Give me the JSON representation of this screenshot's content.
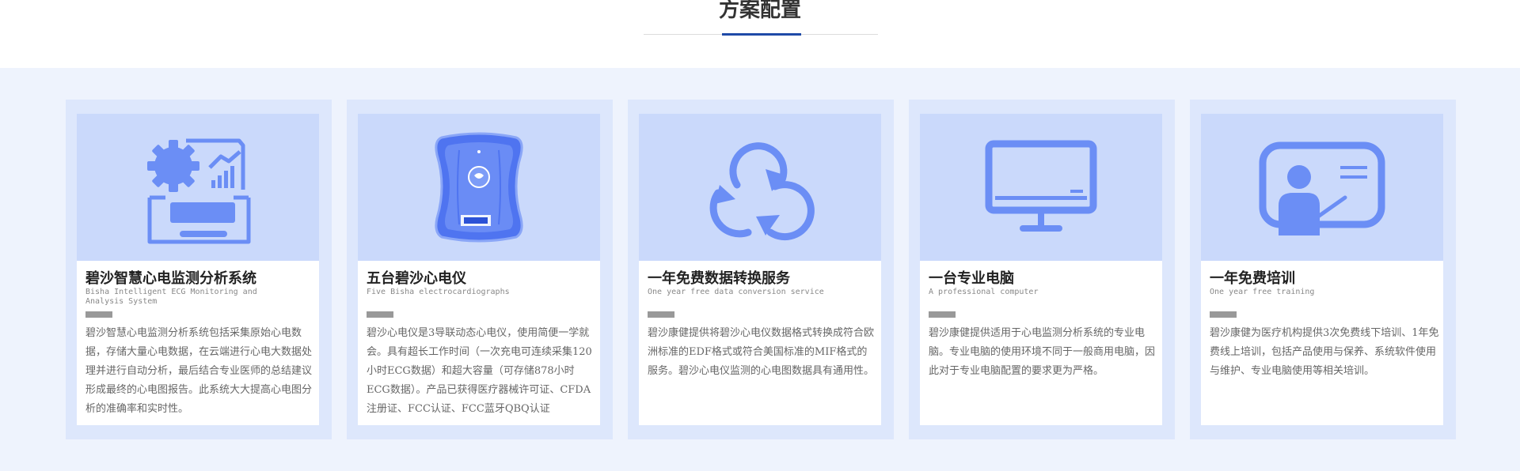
{
  "section": {
    "title": "方案配置"
  },
  "colors": {
    "accent": "#1f4aa8",
    "icon": "#6b8ef5",
    "image_bg": "#cad9fb",
    "card_bg": "#dde7fc",
    "band_bg": "#eef3fd"
  },
  "cards": [
    {
      "icon": "gear-analytics-tray-icon",
      "title": "碧沙智慧心电监测分析系统",
      "subtitle": "Bisha Intelligent ECG Monitoring and Analysis System",
      "description": "碧沙智慧心电监测分析系统包括采集原始心电数据，存储大量心电数据，在云端进行心电大数据处理并进行自动分析，最后结合专业医师的总结建议形成最终的心电图报告。此系统大大提高心电图分析的准确率和实时性。"
    },
    {
      "icon": "ecg-device-icon",
      "title": "五台碧沙心电仪",
      "subtitle": "Five Bisha electrocardiographs",
      "description": "碧沙心电仪是3导联动态心电仪，使用简便一学就会。具有超长工作时间（一次充电可连续采集120小时ECG数据）和超大容量（可存储878小时ECG数据）。产品已获得医疗器械许可证、CFDA注册证、FCC认证、FCC蓝牙QBQ认证"
    },
    {
      "icon": "cloud-sync-icon",
      "title": "一年免费数据转换服务",
      "subtitle": "One year free data conversion service",
      "description": "碧沙康健提供将碧沙心电仪数据格式转换成符合欧洲标准的EDF格式或符合美国标准的MIF格式的服务。碧沙心电仪监测的心电图数据具有通用性。"
    },
    {
      "icon": "monitor-icon",
      "title": "一台专业电脑",
      "subtitle": "A professional computer",
      "description": "碧沙康健提供适用于心电监测分析系统的专业电脑。专业电脑的使用环境不同于一般商用电脑，因此对于专业电脑配置的要求更为严格。"
    },
    {
      "icon": "training-board-icon",
      "title": "一年免费培训",
      "subtitle": "One year free training",
      "description": "碧沙康健为医疗机构提供3次免费线下培训、1年免费线上培训，包括产品使用与保养、系统软件使用与维护、专业电脑使用等相关培训。"
    }
  ]
}
